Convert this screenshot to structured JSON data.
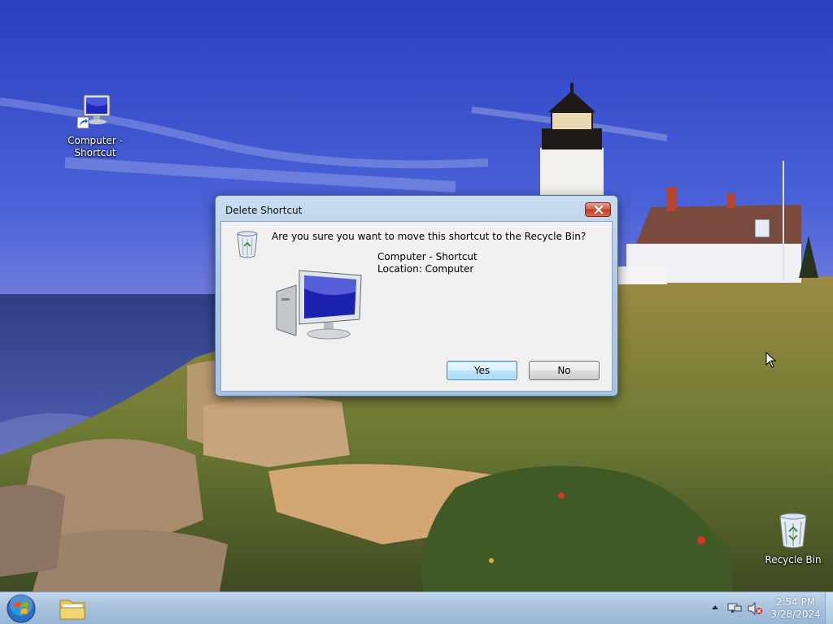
{
  "desktop": {
    "icons": [
      {
        "label_line1": "Computer -",
        "label_line2": "Shortcut",
        "icon": "computer-shortcut-icon"
      },
      {
        "label": "Recycle Bin",
        "icon": "recycle-bin-icon"
      }
    ]
  },
  "dialog": {
    "title": "Delete Shortcut",
    "close_icon": "close-icon",
    "question": "Are you sure you want to move this shortcut to the Recycle Bin?",
    "item_name": "Computer - Shortcut",
    "item_location": "Location: Computer",
    "yes_label": "Yes",
    "no_label": "No"
  },
  "taskbar": {
    "start_icon": "windows-logo-icon",
    "pinned": [
      {
        "icon": "file-explorer-icon"
      }
    ],
    "tray": {
      "icons": [
        "show-hidden-icons-arrow",
        "network-icon",
        "volume-muted-icon"
      ],
      "time": "2:54 PM",
      "date": "3/28/2024"
    }
  },
  "colors": {
    "dialog_frame": "#b2cbe6",
    "close_button": "#c23b22",
    "default_button_border": "#3c7fb1",
    "taskbar": "#a9c2dd"
  }
}
